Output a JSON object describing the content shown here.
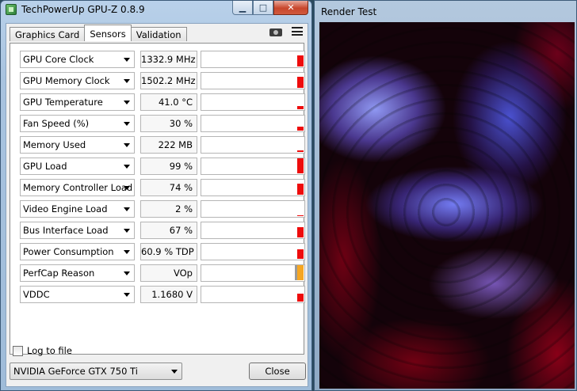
{
  "window": {
    "title": "TechPowerUp GPU-Z 0.8.9"
  },
  "tabs": [
    {
      "label": "Graphics Card",
      "active": false
    },
    {
      "label": "Sensors",
      "active": true
    },
    {
      "label": "Validation",
      "active": false
    }
  ],
  "toolbar": {
    "screenshot_icon": "camera-icon",
    "menu_icon": "menu-icon"
  },
  "sensors": [
    {
      "name": "GPU Core Clock",
      "value": "1332.9 MHz",
      "level": 0.72,
      "color": "#ee0c0c"
    },
    {
      "name": "GPU Memory Clock",
      "value": "1502.2 MHz",
      "level": 0.72,
      "color": "#ee0c0c"
    },
    {
      "name": "GPU Temperature",
      "value": "41.0 °C",
      "level": 0.2,
      "color": "#ee0c0c"
    },
    {
      "name": "Fan Speed (%)",
      "value": "30 %",
      "level": 0.25,
      "color": "#ee0c0c"
    },
    {
      "name": "Memory Used",
      "value": "222 MB",
      "level": 0.08,
      "color": "#ee0c0c"
    },
    {
      "name": "GPU Load",
      "value": "99 %",
      "level": 0.95,
      "color": "#ee0c0c"
    },
    {
      "name": "Memory Controller Load",
      "value": "74 %",
      "level": 0.72,
      "color": "#ee0c0c"
    },
    {
      "name": "Video Engine Load",
      "value": "2 %",
      "level": 0.05,
      "color": "#ee0c0c"
    },
    {
      "name": "Bus Interface Load",
      "value": "67 %",
      "level": 0.65,
      "color": "#ee0c0c"
    },
    {
      "name": "Power Consumption",
      "value": "60.9 % TDP",
      "level": 0.6,
      "color": "#ee0c0c"
    },
    {
      "name": "PerfCap Reason",
      "value": "VOp",
      "level": 0.95,
      "color": "#f5a623"
    },
    {
      "name": "VDDC",
      "value": "1.1680 V",
      "level": 0.5,
      "color": "#ee0c0c"
    }
  ],
  "log": {
    "label": "Log to file",
    "checked": false
  },
  "gpu_select": {
    "value": "NVIDIA GeForce GTX 750 Ti"
  },
  "buttons": {
    "close": "Close"
  },
  "render_test": {
    "title": "Render Test"
  },
  "colors": {
    "graph_bar": "#ee0c0c",
    "perfcap_bar": "#f5a623"
  }
}
